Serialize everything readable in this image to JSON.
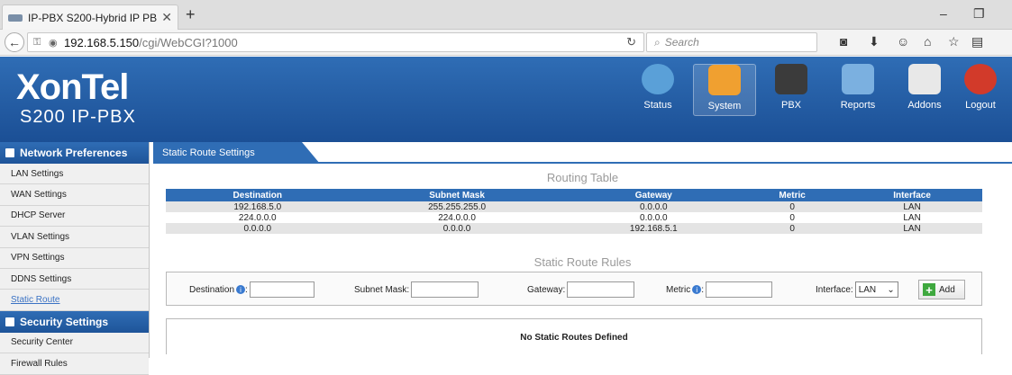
{
  "browser": {
    "tab_title": "IP-PBX S200-Hybrid IP PB...",
    "url_host": "192.168.5.150",
    "url_path": "/cgi/WebCGI?1000",
    "search_placeholder": "Search"
  },
  "brand": {
    "name": "XonTel",
    "model": "S200 IP-PBX"
  },
  "topnav": [
    {
      "label": "Status",
      "icon": "status-icon",
      "color": "#5aa0d8"
    },
    {
      "label": "System",
      "icon": "system-icon",
      "color": "#f0a030"
    },
    {
      "label": "PBX",
      "icon": "pbx-icon",
      "color": "#3b3b3b"
    },
    {
      "label": "Reports",
      "icon": "reports-icon",
      "color": "#7bb0e0"
    },
    {
      "label": "Addons",
      "icon": "addons-icon",
      "color": "#e8e8e8"
    },
    {
      "label": "Logout",
      "icon": "logout-icon",
      "color": "#d23a2a"
    }
  ],
  "sidebar": {
    "network_header": "Network Preferences",
    "network_items": [
      "LAN Settings",
      "WAN Settings",
      "DHCP Server",
      "VLAN Settings",
      "VPN Settings",
      "DDNS Settings",
      "Static Route"
    ],
    "security_header": "Security Settings",
    "security_items": [
      "Security Center",
      "Firewall Rules"
    ]
  },
  "page": {
    "tab_label": "Static Route Settings",
    "routing_title": "Routing Table",
    "columns": [
      "Destination",
      "Subnet Mask",
      "Gateway",
      "Metric",
      "Interface"
    ],
    "rows": [
      [
        "192.168.5.0",
        "255.255.255.0",
        "0.0.0.0",
        "0",
        "LAN"
      ],
      [
        "224.0.0.0",
        "224.0.0.0",
        "0.0.0.0",
        "0",
        "LAN"
      ],
      [
        "0.0.0.0",
        "0.0.0.0",
        "192.168.5.1",
        "0",
        "LAN"
      ]
    ],
    "rules_title": "Static Route Rules",
    "form": {
      "destination_label": "Destination",
      "subnet_label": "Subnet Mask:",
      "gateway_label": "Gateway:",
      "metric_label": "Metric",
      "interface_label": "Interface:",
      "interface_value": "LAN",
      "add_label": "Add"
    },
    "empty_message": "No Static Routes Defined"
  }
}
